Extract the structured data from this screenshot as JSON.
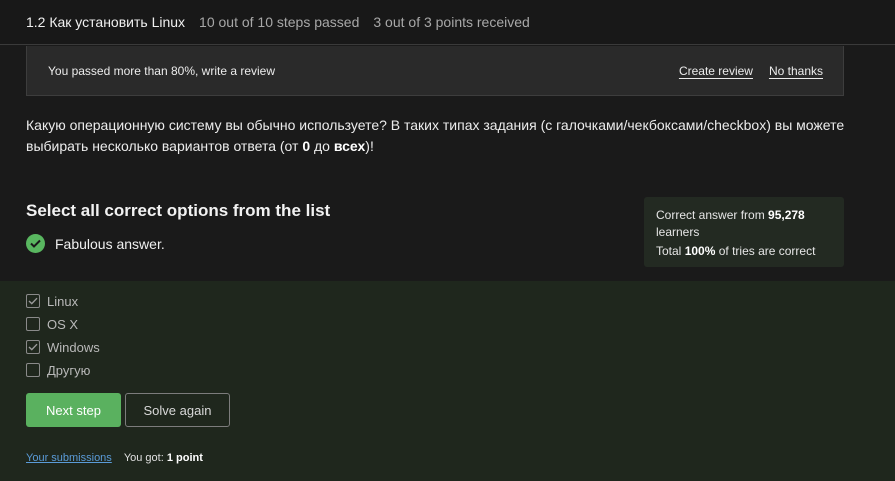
{
  "header": {
    "title": "1.2 Как установить Linux",
    "steps_passed": "10 out of 10 steps passed",
    "points_received": "3 out of 3 points  received"
  },
  "review_banner": {
    "message": "You passed more than 80%, write a review",
    "create_review": "Create review",
    "no_thanks": "No thanks"
  },
  "question": {
    "text_part1": "Какую операционную систему вы обычно используете? В таких типах задания (с галочками/чекбоксами/checkbox) вы можете выбирать несколько вариантов ответа (от ",
    "bold1": "0",
    "text_part2": " до ",
    "bold2": "всех",
    "text_part3": ")!"
  },
  "instruction": "Select all correct options from the list",
  "result_text": "Fabulous answer.",
  "stats": {
    "prefix": "Correct answer from ",
    "learners_count": "95,278",
    "learners_suffix": "learners",
    "total_prefix": "Total ",
    "percent": "100%",
    "total_suffix": " of tries are correct"
  },
  "options": [
    {
      "label": "Linux",
      "checked": true
    },
    {
      "label": "OS X",
      "checked": false
    },
    {
      "label": "Windows",
      "checked": true
    },
    {
      "label": "Другую",
      "checked": false
    }
  ],
  "buttons": {
    "next_step": "Next step",
    "solve_again": "Solve again"
  },
  "footer": {
    "submissions_link": "Your submissions",
    "got_prefix": "You got: ",
    "got_value": "1 point"
  },
  "colors": {
    "accent_green": "#5ab15f",
    "answer_bg": "#1f271d",
    "link_blue": "#5a9bd8"
  }
}
